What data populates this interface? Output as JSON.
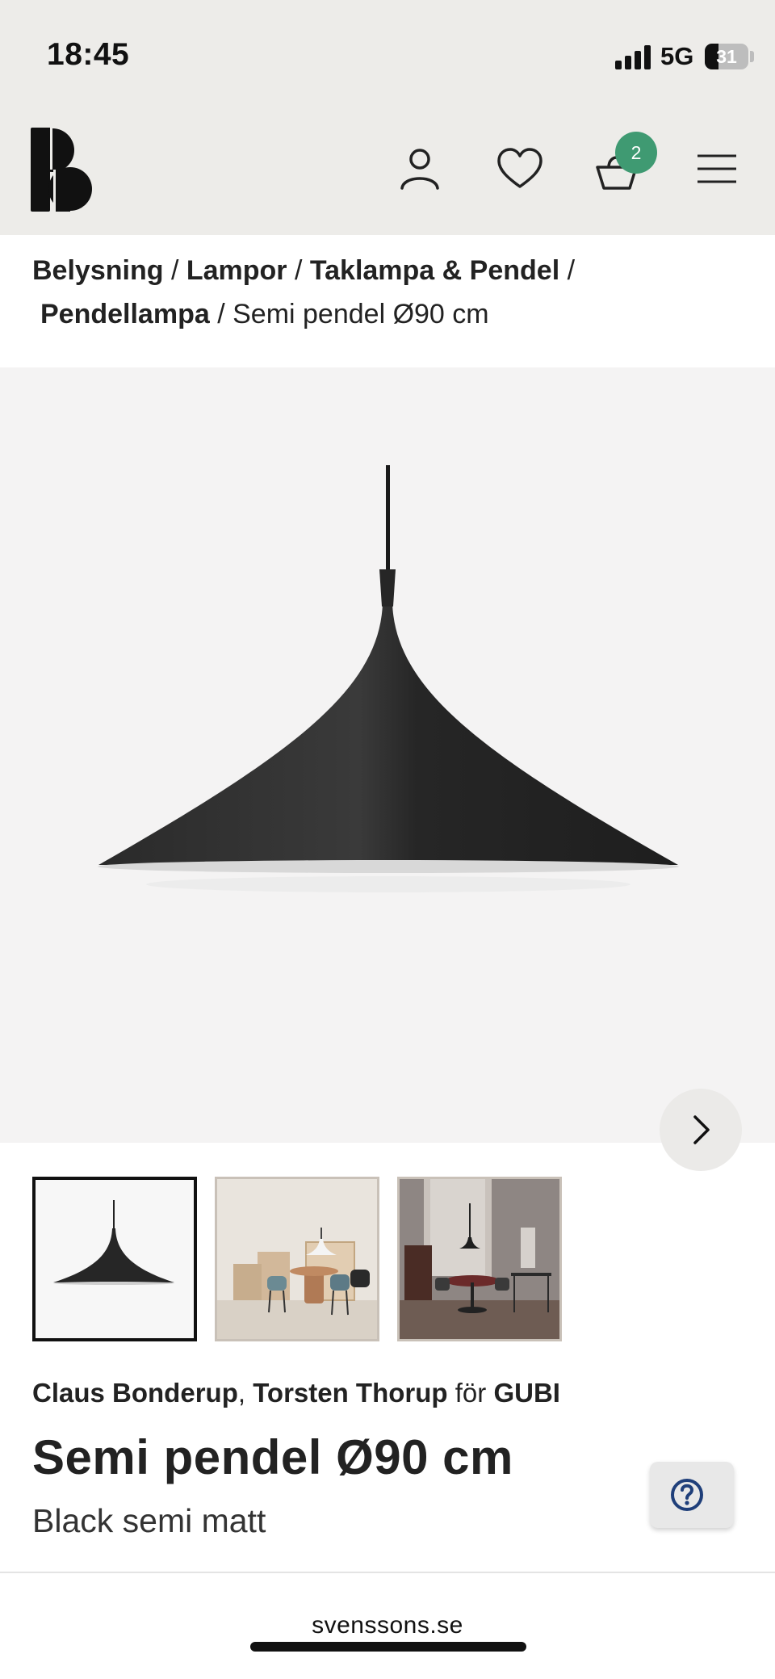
{
  "status_bar": {
    "time": "18:45",
    "network": "5G",
    "battery": "31",
    "battery_level": 0.31
  },
  "header": {
    "logo_icon": "svenssons-s-logo",
    "icons": [
      "user-icon",
      "heart-icon",
      "basket-icon",
      "menu-icon"
    ],
    "cart_count": "2",
    "badge_color": "#3f9a72"
  },
  "breadcrumb": {
    "items": [
      "Belysning",
      "Lampor",
      "Taklampa & Pendel",
      "Pendellampa"
    ],
    "separator": "/",
    "current": "Semi pendel Ø90 cm"
  },
  "gallery": {
    "next_icon": "chevron-right-icon",
    "thumbnails": [
      "thumbnail-lamp-product",
      "thumbnail-dining-room-light",
      "thumbnail-dining-room-dark"
    ],
    "active_index": 0
  },
  "product": {
    "designer_1": "Claus Bonderup",
    "designer_sep": ",",
    "designer_2": "Torsten Thorup",
    "for_word": "för",
    "brand": "GUBI",
    "title": "Semi pendel Ø90 cm",
    "variant": "Black semi matt"
  },
  "help": {
    "icon": "help-icon"
  },
  "browser": {
    "url": "svenssons.se"
  }
}
